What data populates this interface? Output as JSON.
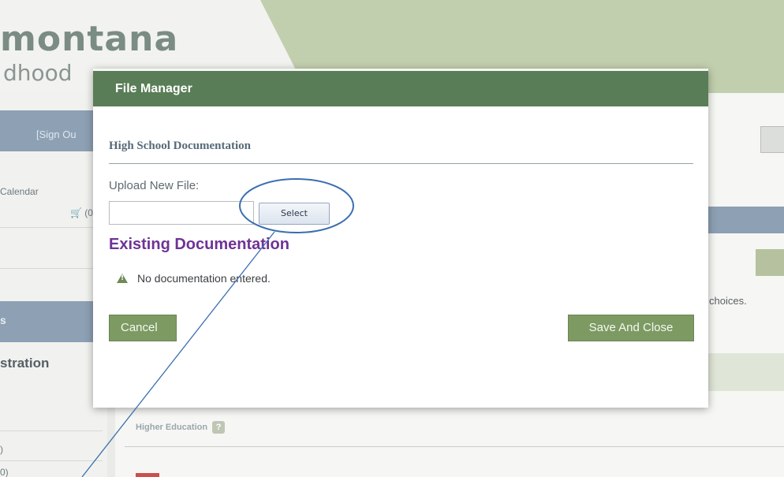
{
  "background": {
    "logo": {
      "main_text": "montana",
      "sub_text": "dhood"
    },
    "sidebar": {
      "sign_out": "[Sign Ou",
      "calendar": "Calendar",
      "cart_count": "(0)",
      "band_text": "s",
      "heading": "stration",
      "count_1": ")",
      "count_2": "0)"
    },
    "main": {
      "choices_text": "choices.",
      "higher_education": "Higher Education",
      "help_glyph": "?"
    }
  },
  "modal": {
    "title": "File Manager",
    "section_title": "High School Documentation",
    "upload_label": "Upload New File:",
    "file_input_value": "",
    "select_button": "Select",
    "existing_title": "Existing Documentation",
    "notice_text": "No documentation entered.",
    "notice_icon": "warning-icon",
    "cancel_button": "Cancel",
    "save_button": "Save And Close"
  },
  "colors": {
    "modal_titlebar": "#597d56",
    "button_green": "#7d9a63",
    "existing_title_purple": "#6e3396",
    "annotation_blue": "#3b6fb0"
  }
}
